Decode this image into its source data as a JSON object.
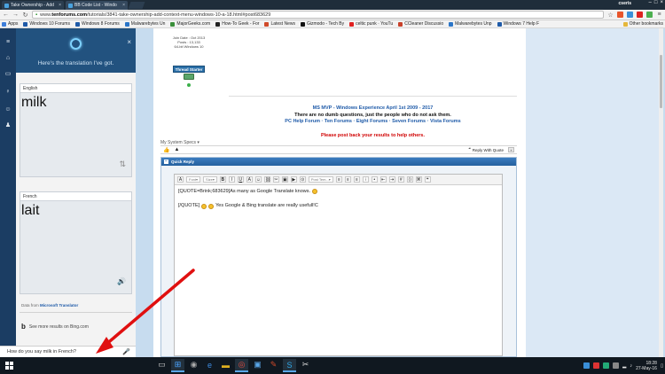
{
  "browser": {
    "tabs": [
      {
        "label": "Take Ownership - Add",
        "active": false
      },
      {
        "label": "BB Code List - Windo",
        "active": true
      }
    ],
    "profile_name": "cseris",
    "address": {
      "prefix": "www.",
      "host": "tenforums.com",
      "path": "/tutorials/3841-take-ownership-add-context-menu-windows-10-a-18.html#post683629"
    },
    "bookmarks": [
      {
        "label": "Apps",
        "color": "#3c7dd9"
      },
      {
        "label": "Windows 10 Forums",
        "color": "#1e5aa8"
      },
      {
        "label": "Windows 8 Forums",
        "color": "#1e5aa8"
      },
      {
        "label": "Malwarebytes Un",
        "color": "#2a75c8"
      },
      {
        "label": "MajorGeeks.com",
        "color": "#3a8f3a"
      },
      {
        "label": "How-To Geek - For",
        "color": "#222222"
      },
      {
        "label": "Latest News",
        "color": "#d04a2a"
      },
      {
        "label": "Gizmodo - Tech By",
        "color": "#111111"
      },
      {
        "label": "celtic punk · YouTu",
        "color": "#e02020"
      },
      {
        "label": "CCleaner Discussio",
        "color": "#c8412a"
      },
      {
        "label": "Malwarebytes Unp",
        "color": "#2a75c8"
      },
      {
        "label": "Windows 7 Help F",
        "color": "#1e5aa8"
      }
    ],
    "other_bookmarks": "Other bookmarks"
  },
  "post": {
    "user_info": [
      "Join Date : Oct 2013",
      "Posts : 13,133",
      "64-bit Windows 10",
      "Thread Starter"
    ],
    "thread_starter_label": "Thread Starter",
    "signature": {
      "line1": "MS MVP - Windows Experience April 1st 2009 - 2017",
      "line2": "There are no dumb questions, just the people who do not ask them.",
      "line3": "PC Help Forum · Ten Forums · Eight Forums · Seven Forums · Vista Forums",
      "warning": "Please post back your results to help others."
    },
    "system_specs": "My System Specs",
    "reply_with_quote": "Reply With Quote"
  },
  "quick_reply": {
    "title": "Quick Reply",
    "font_select": "Font",
    "size_select": "Size",
    "post_icons_select": "Post Tem...",
    "text_line1": "[QUOTE=Brink;683629]As many as Google Translate knows.",
    "text_line2_prefix": "[/QUOTE]",
    "text_line2_suffix": " Yes Google & Bing translate are really usefull!C"
  },
  "cortana": {
    "header_message": "Here's the translation I've got.",
    "source_lang": "English",
    "source_word": "milk",
    "target_lang": "French",
    "target_word": "lait",
    "data_from_prefix": "Data from",
    "data_from_source": "Microsoft Translator",
    "bing_more": "See more results on Bing.com",
    "search_query": "How do you say milk in French?"
  },
  "taskbar": {
    "time": "18:28",
    "date": "27-May-16"
  }
}
